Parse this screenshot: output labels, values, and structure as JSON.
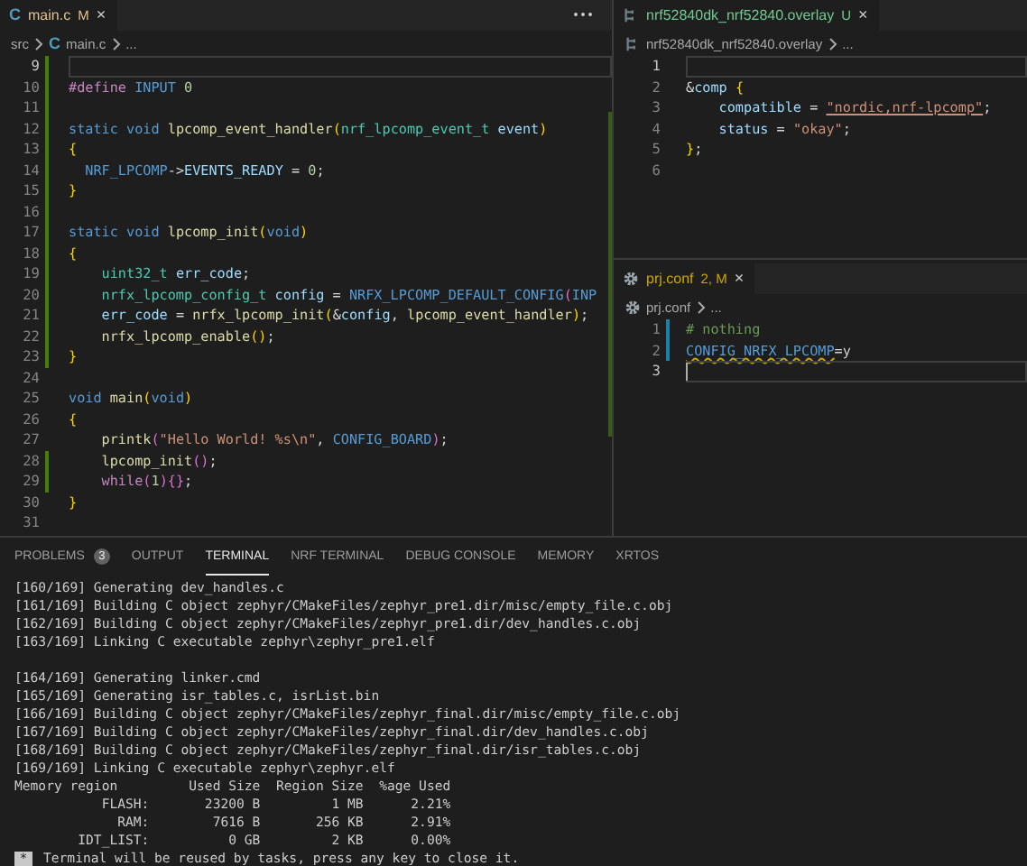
{
  "left_editor": {
    "tab": {
      "label": "main.c",
      "kind": "c",
      "icon_text": "C",
      "color": "#e2c08d",
      "badge": "M",
      "close": "×"
    },
    "breadcrumbs": [
      {
        "text": "src",
        "kind": "folder"
      },
      {
        "text": "main.c",
        "kind": "c",
        "icon_text": "C"
      },
      {
        "text": "...",
        "kind": "more"
      }
    ],
    "lines": [
      {
        "n": "9",
        "modified": true,
        "current": true
      },
      {
        "n": "10",
        "modified": true,
        "current": false,
        "tokens": [
          {
            "text": "#define",
            "kind": "ctl"
          },
          {
            "text": " INPUT ",
            "kind": "kw"
          },
          {
            "text": "0",
            "kind": "num"
          }
        ]
      },
      {
        "n": "11",
        "modified": true,
        "current": false
      },
      {
        "n": "12",
        "modified": true,
        "current": false,
        "tokens": [
          {
            "text": "static void ",
            "kind": "kw"
          },
          {
            "text": "lpcomp_event_handler",
            "kind": "fn"
          },
          {
            "text": "(",
            "kind": "brace"
          },
          {
            "text": "nrf_lpcomp_event_t ",
            "kind": "type"
          },
          {
            "text": "event",
            "kind": "var"
          },
          {
            "text": ")",
            "kind": "brace"
          }
        ]
      },
      {
        "n": "13",
        "modified": true,
        "current": false,
        "tokens": [
          {
            "text": "{",
            "kind": "brace"
          }
        ]
      },
      {
        "n": "14",
        "modified": true,
        "current": false,
        "tokens": [
          {
            "text": "  NRF_LPCOMP",
            "kind": "macro"
          },
          {
            "text": "->",
            "kind": "plain"
          },
          {
            "text": "EVENTS_READY",
            "kind": "var"
          },
          {
            "text": " = ",
            "kind": "plain"
          },
          {
            "text": "0",
            "kind": "num"
          },
          {
            "text": ";",
            "kind": "plain"
          }
        ]
      },
      {
        "n": "15",
        "modified": true,
        "current": false,
        "tokens": [
          {
            "text": "}",
            "kind": "brace"
          }
        ]
      },
      {
        "n": "16",
        "modified": true,
        "current": false
      },
      {
        "n": "17",
        "modified": true,
        "current": false,
        "tokens": [
          {
            "text": "static void ",
            "kind": "kw"
          },
          {
            "text": "lpcomp_init",
            "kind": "fn"
          },
          {
            "text": "(",
            "kind": "brace"
          },
          {
            "text": "void",
            "kind": "kw"
          },
          {
            "text": ")",
            "kind": "brace"
          }
        ]
      },
      {
        "n": "18",
        "modified": true,
        "current": false,
        "tokens": [
          {
            "text": "{",
            "kind": "brace"
          }
        ]
      },
      {
        "n": "19",
        "modified": true,
        "current": false,
        "tokens": [
          {
            "text": "    uint32_t ",
            "kind": "type"
          },
          {
            "text": "err_code",
            "kind": "var"
          },
          {
            "text": ";",
            "kind": "plain"
          }
        ]
      },
      {
        "n": "20",
        "modified": true,
        "current": false,
        "tokens": [
          {
            "text": "    nrfx_lpcomp_config_t ",
            "kind": "type"
          },
          {
            "text": "config",
            "kind": "var"
          },
          {
            "text": " = ",
            "kind": "plain"
          },
          {
            "text": "NRFX_LPCOMP_DEFAULT_CONFIG",
            "kind": "macro"
          },
          {
            "text": "(",
            "kind": "paren"
          },
          {
            "text": "INP",
            "kind": "macro"
          }
        ]
      },
      {
        "n": "21",
        "modified": true,
        "current": false,
        "tokens": [
          {
            "text": "    err_code",
            "kind": "var"
          },
          {
            "text": " = ",
            "kind": "plain"
          },
          {
            "text": "nrfx_lpcomp_init",
            "kind": "fn"
          },
          {
            "text": "(",
            "kind": "brace"
          },
          {
            "text": "&",
            "kind": "plain"
          },
          {
            "text": "config",
            "kind": "var"
          },
          {
            "text": ", ",
            "kind": "plain"
          },
          {
            "text": "lpcomp_event_handler",
            "kind": "fn"
          },
          {
            "text": ")",
            "kind": "brace"
          },
          {
            "text": ";",
            "kind": "plain"
          }
        ]
      },
      {
        "n": "22",
        "modified": true,
        "current": false,
        "tokens": [
          {
            "text": "    nrfx_lpcomp_enable",
            "kind": "fn"
          },
          {
            "text": "()",
            "kind": "brace"
          },
          {
            "text": ";",
            "kind": "plain"
          }
        ]
      },
      {
        "n": "23",
        "modified": true,
        "current": false,
        "tokens": [
          {
            "text": "}",
            "kind": "brace"
          }
        ]
      },
      {
        "n": "24",
        "modified": false,
        "current": false
      },
      {
        "n": "25",
        "modified": false,
        "current": false,
        "tokens": [
          {
            "text": "void ",
            "kind": "kw"
          },
          {
            "text": "main",
            "kind": "fn"
          },
          {
            "text": "(",
            "kind": "brace"
          },
          {
            "text": "void",
            "kind": "kw"
          },
          {
            "text": ")",
            "kind": "brace"
          }
        ]
      },
      {
        "n": "26",
        "modified": false,
        "current": false,
        "tokens": [
          {
            "text": "{",
            "kind": "brace"
          }
        ]
      },
      {
        "n": "27",
        "modified": false,
        "current": false,
        "tokens": [
          {
            "text": "    printk",
            "kind": "fn"
          },
          {
            "text": "(",
            "kind": "paren"
          },
          {
            "text": "\"Hello World! %s\\n\"",
            "kind": "str"
          },
          {
            "text": ", ",
            "kind": "plain"
          },
          {
            "text": "CONFIG_BOARD",
            "kind": "macro"
          },
          {
            "text": ")",
            "kind": "paren"
          },
          {
            "text": ";",
            "kind": "plain"
          }
        ]
      },
      {
        "n": "28",
        "modified": true,
        "current": false,
        "tokens": [
          {
            "text": "    lpcomp_init",
            "kind": "fn"
          },
          {
            "text": "()",
            "kind": "paren"
          },
          {
            "text": ";",
            "kind": "plain"
          }
        ]
      },
      {
        "n": "29",
        "modified": true,
        "current": false,
        "tokens": [
          {
            "text": "    while",
            "kind": "ctl"
          },
          {
            "text": "(",
            "kind": "paren"
          },
          {
            "text": "1",
            "kind": "num"
          },
          {
            "text": ")",
            "kind": "paren"
          },
          {
            "text": "{}",
            "kind": "paren"
          },
          {
            "text": ";",
            "kind": "plain"
          }
        ]
      },
      {
        "n": "30",
        "modified": false,
        "current": false,
        "tokens": [
          {
            "text": "}",
            "kind": "brace"
          }
        ]
      },
      {
        "n": "31",
        "modified": false,
        "current": false
      }
    ]
  },
  "overlay_editor": {
    "tab": {
      "label": "nrf52840dk_nrf52840.overlay",
      "kind": "devicetree",
      "color": "#73c991",
      "badge": "U",
      "close": "×"
    },
    "breadcrumbs": [
      {
        "text": "nrf52840dk_nrf52840.overlay",
        "kind": "devicetree"
      },
      {
        "text": "...",
        "kind": "more"
      }
    ],
    "lines": [
      {
        "n": "1",
        "current": true
      },
      {
        "n": "2",
        "current": false,
        "tokens": [
          {
            "text": "&",
            "kind": "plain"
          },
          {
            "text": "comp ",
            "kind": "var"
          },
          {
            "text": "{",
            "kind": "brace"
          }
        ]
      },
      {
        "n": "3",
        "current": false,
        "tokens": [
          {
            "text": "    compatible",
            "kind": "var"
          },
          {
            "text": " = ",
            "kind": "plain"
          },
          {
            "text": "\"nordic,nrf-lpcomp\"",
            "kind": "link"
          },
          {
            "text": ";",
            "kind": "plain"
          }
        ]
      },
      {
        "n": "4",
        "current": false,
        "tokens": [
          {
            "text": "    status",
            "kind": "var"
          },
          {
            "text": " = ",
            "kind": "plain"
          },
          {
            "text": "\"okay\"",
            "kind": "str"
          },
          {
            "text": ";",
            "kind": "plain"
          }
        ]
      },
      {
        "n": "5",
        "current": false,
        "tokens": [
          {
            "text": "}",
            "kind": "brace"
          },
          {
            "text": ";",
            "kind": "plain"
          }
        ]
      },
      {
        "n": "6",
        "current": false
      }
    ]
  },
  "conf_editor": {
    "tab": {
      "label": "prj.conf",
      "kind": "settings",
      "color": "#cca700",
      "badge": "2, M",
      "close": "×"
    },
    "breadcrumbs": [
      {
        "text": "prj.conf",
        "kind": "settings"
      },
      {
        "text": "...",
        "kind": "more"
      }
    ],
    "lines": [
      {
        "n": "1",
        "added": true,
        "current": false,
        "tokens": [
          {
            "text": "# nothing",
            "kind": "comment"
          }
        ]
      },
      {
        "n": "2",
        "added": true,
        "current": false,
        "tokens": [
          {
            "text": "CONFIG_NRFX_LPCOMP",
            "kind": "warn"
          },
          {
            "text": "=y",
            "kind": "plain"
          }
        ]
      },
      {
        "n": "3",
        "added": false,
        "current": true,
        "cursor": true
      }
    ]
  },
  "panel": {
    "tabs": [
      {
        "label": "PROBLEMS",
        "badge": "3",
        "selected": false
      },
      {
        "label": "OUTPUT",
        "selected": false
      },
      {
        "label": "TERMINAL",
        "selected": true
      },
      {
        "label": "NRF TERMINAL",
        "selected": false
      },
      {
        "label": "DEBUG CONSOLE",
        "selected": false
      },
      {
        "label": "MEMORY",
        "selected": false
      },
      {
        "label": "XRTOS",
        "selected": false
      }
    ],
    "terminal_blocks": [
      [
        "[160/169] Generating dev_handles.c",
        "[161/169] Building C object zephyr/CMakeFiles/zephyr_pre1.dir/misc/empty_file.c.obj",
        "[162/169] Building C object zephyr/CMakeFiles/zephyr_pre1.dir/dev_handles.c.obj",
        "[163/169] Linking C executable zephyr\\zephyr_pre1.elf"
      ],
      [
        "[164/169] Generating linker.cmd",
        "[165/169] Generating isr_tables.c, isrList.bin",
        "[166/169] Building C object zephyr/CMakeFiles/zephyr_final.dir/misc/empty_file.c.obj",
        "[167/169] Building C object zephyr/CMakeFiles/zephyr_final.dir/dev_handles.c.obj",
        "[168/169] Building C object zephyr/CMakeFiles/zephyr_final.dir/isr_tables.c.obj",
        "[169/169] Linking C executable zephyr\\zephyr.elf",
        "Memory region         Used Size  Region Size  %age Used",
        "           FLASH:       23200 B         1 MB      2.21%",
        "             RAM:        7616 B       256 KB      2.91%",
        "        IDT_LIST:          0 GB         2 KB      0.00%"
      ]
    ],
    "notice": {
      "marker": "*",
      "text": "Terminal will be reused by tasks, press any key to close it."
    }
  }
}
